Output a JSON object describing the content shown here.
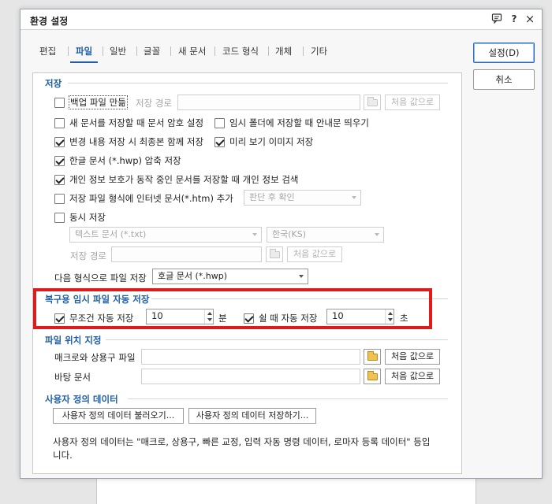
{
  "window": {
    "title": "환경 설정",
    "help_glyph": "?",
    "close_glyph": "×"
  },
  "tabs": [
    {
      "label": "편집"
    },
    {
      "label": "파일"
    },
    {
      "label": "일반"
    },
    {
      "label": "글꼴"
    },
    {
      "label": "새 문서"
    },
    {
      "label": "코드 형식"
    },
    {
      "label": "개체"
    },
    {
      "label": "기타"
    }
  ],
  "active_tab": "파일",
  "buttons": {
    "ok": "설정(D)",
    "cancel": "취소"
  },
  "save_group": {
    "title": "저장",
    "backup_label": "백업 파일 만듦",
    "backup_checked": false,
    "save_path_label": "저장 경로",
    "save_path_value": "",
    "reset_label": "처음 값으로",
    "password_label": "새 문서를 저장할 때 문서 암호 설정",
    "password_checked": false,
    "temp_folder_label": "임시 폴더에 저장할 때 안내문 띄우기",
    "temp_folder_checked": false,
    "changes_label": "변경 내용 저장 시 최종본 함께 저장",
    "changes_checked": true,
    "preview_label": "미리 보기 이미지 저장",
    "preview_checked": true,
    "compress_label": "한글 문서 (*.hwp) 압축 저장",
    "compress_checked": true,
    "privacy_label": "개인 정보 보호가 동작 중인 문서를 저장할 때 개인 정보 검색",
    "privacy_checked": true,
    "internet_label": "저장 파일 형식에 인터넷 문서(*.htm) 추가",
    "internet_checked": false,
    "internet_select": "판단 후 확인",
    "simul_label": "동시 저장",
    "simul_checked": false,
    "simul_format": "텍스트 문서 (*.txt)",
    "simul_encoding": "한국(KS)",
    "simul_path_label": "저장 경로",
    "simul_path_value": "",
    "default_format_label": "다음 형식으로 파일 저장",
    "default_format_value": "호글 문서 (*.hwp)"
  },
  "autosave_group": {
    "title": "복구용 임시 파일 자동 저장",
    "always_label": "무조건 자동 저장",
    "always_checked": true,
    "always_value": "10",
    "always_unit": "분",
    "idle_label": "쉴 때 자동 저장",
    "idle_checked": true,
    "idle_value": "10",
    "idle_unit": "초"
  },
  "location_group": {
    "title": "파일 위치 지정",
    "macro_label": "매크로와 상용구 파일",
    "macro_value": "",
    "desktop_label": "바탕 문서",
    "desktop_value": "",
    "reset_label": "처음 값으로"
  },
  "userdata_group": {
    "title": "사용자 정의 데이터",
    "load_label": "사용자 정의 데이터 불러오기...",
    "save_label": "사용자 정의 데이터 저장하기...",
    "description": "사용자 정의 데이터는 \"매크로, 상용구, 빠른 교정, 입력 자동 명령 데이터, 로마자 등록 데이터\" 등입니다."
  },
  "colors": {
    "accent": "#1f5fa8",
    "highlight": "#e01b1b"
  }
}
